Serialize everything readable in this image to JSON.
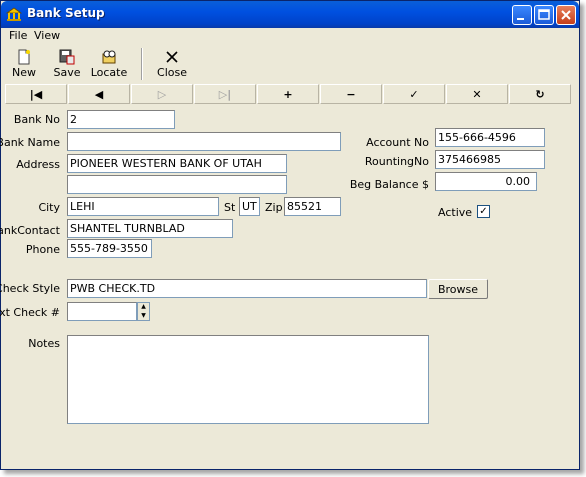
{
  "window": {
    "title": "Bank Setup"
  },
  "menu": [
    "File",
    "View"
  ],
  "toolbar": {
    "new": "New",
    "save": "Save",
    "locate": "Locate",
    "close": "Close"
  },
  "nav": [
    "|◀",
    "◀",
    "▷",
    "▷|",
    "+",
    "−",
    "✓",
    "✕",
    "↻"
  ],
  "labels": {
    "bank_no": "Bank No",
    "bank_name": "Bank Name",
    "address": "Address",
    "city": "City",
    "st": "St",
    "zip": "Zip",
    "bank_contact": "BankContact",
    "phone": "Phone",
    "account_no": "Account No",
    "routing_no": "RountingNo",
    "beg_balance": "Beg Balance $",
    "active": "Active",
    "check_style": "Check Style",
    "next_check": "Next Check #",
    "notes": "Notes",
    "browse": "Browse"
  },
  "values": {
    "bank_no": "2",
    "bank_name": "",
    "address1": "PIONEER WESTERN BANK OF UTAH",
    "address2": "",
    "city": "LEHI",
    "st": "UT",
    "zip": "85521",
    "bank_contact": "SHANTEL TURNBLAD",
    "phone": "555-789-3550",
    "account_no": "155-666-4596",
    "routing_no": "375466985",
    "beg_balance": "0.00",
    "active_mark": "✓",
    "check_style": "PWB CHECK.TD",
    "next_check": "",
    "notes": ""
  }
}
